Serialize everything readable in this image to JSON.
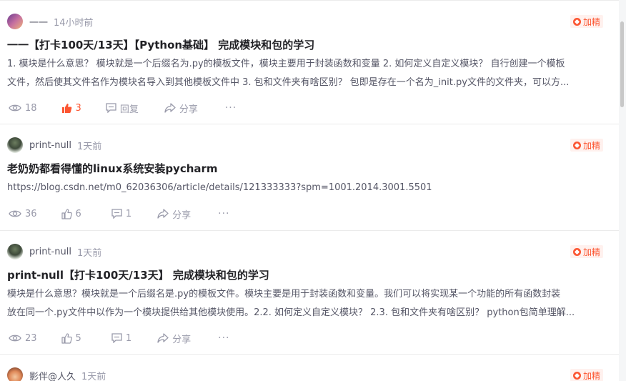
{
  "posts": [
    {
      "author": "一一",
      "time": "14小时前",
      "badge": "加精",
      "title": "一一【打卡100天/13天】【Python基础】 完成模块和包的学习",
      "excerpt_lines": [
        "1. 模块是什么意思？ 模块就是一个后缀名为.py的模板文件，模块主要用于封装函数和变量 2. 如何定义自定义模块？ 自行创建一个模板",
        "文件，然后使其文件名作为模块名导入到其他模板文件中 3. 包和文件夹有啥区别？ 包即是存在一个名为_init.py文件的文件夹，可以方..."
      ],
      "views": "18",
      "likes": "3",
      "reply_label": "回复",
      "share_label": "分享",
      "more": "···",
      "liked": true
    },
    {
      "author": "print-null",
      "time": "1天前",
      "badge": "加精",
      "title": "老奶奶都看得懂的linux系统安装pycharm",
      "excerpt_lines": [
        "https://blog.csdn.net/m0_62036306/article/details/121333333?spm=1001.2014.3001.5501"
      ],
      "views": "36",
      "likes": "6",
      "comments": "1",
      "share_label": "分享",
      "more": "···",
      "liked": false
    },
    {
      "author": "print-null",
      "time": "1天前",
      "badge": "加精",
      "title": "print-null【打卡100天/13天】 完成模块和包的学习",
      "excerpt_lines": [
        "模块是什么意思？模块就是一个后缀名是.py的模板文件。模块主要是用于封装函数和变量。我们可以将实现某一个功能的所有函数封装",
        "放在同一个.py文件中以作为一个模块提供给其他模块使用。2.2. 如何定义自定义模块？ 2.3. 包和文件夹有啥区别？ python包简单理解..."
      ],
      "views": "23",
      "likes": "5",
      "comments": "1",
      "share_label": "分享",
      "more": "···",
      "liked": false
    },
    {
      "author": "影伴@人久",
      "time": "1天前",
      "badge": "加精"
    }
  ],
  "colors": {
    "accent": "#fc5531",
    "muted": "#999aaa",
    "text": "#222226"
  }
}
